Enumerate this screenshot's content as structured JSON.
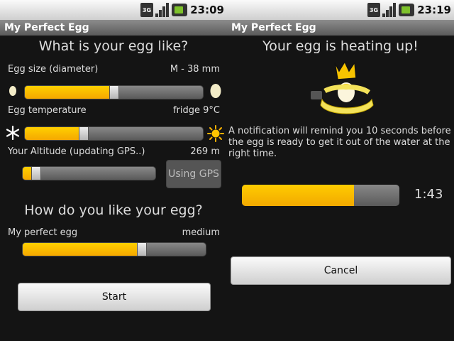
{
  "left": {
    "status": {
      "network": "3G",
      "time": "23:09"
    },
    "app_title": "My Perfect Egg",
    "egg_section_heading": "What is your egg like?",
    "egg_size": {
      "label": "Egg size (diameter)",
      "value": "M - 38 mm",
      "slider_fraction": 0.5
    },
    "egg_temperature": {
      "label": "Egg temperature",
      "value": "fridge 9°C",
      "slider_fraction": 0.33
    },
    "altitude": {
      "label": "Your Altitude (updating GPS..)",
      "value": "269 m",
      "slider_fraction": 0.1,
      "gps_button": "Using GPS"
    },
    "preference_heading": "How do you like your egg?",
    "perfect_egg": {
      "label": "My perfect egg",
      "value": "medium",
      "slider_fraction": 0.65
    },
    "start_button": "Start"
  },
  "right": {
    "status": {
      "network": "3G",
      "time": "23:19"
    },
    "app_title": "My Perfect Egg",
    "heading": "Your egg is heating up!",
    "notification_text": "A notification will remind you 10 seconds before the egg is ready to get it out of the water at the right time.",
    "progress_fraction": 0.71,
    "timer": "1:43",
    "cancel_button": "Cancel"
  },
  "colors": {
    "accent": "#f5b800",
    "background": "#141414",
    "titlebar": "#6e6e6e"
  },
  "icons": [
    "signal-icon",
    "battery-icon",
    "small-egg-icon",
    "large-egg-icon",
    "snowflake-icon",
    "sun-icon",
    "egg-crown-icon"
  ]
}
